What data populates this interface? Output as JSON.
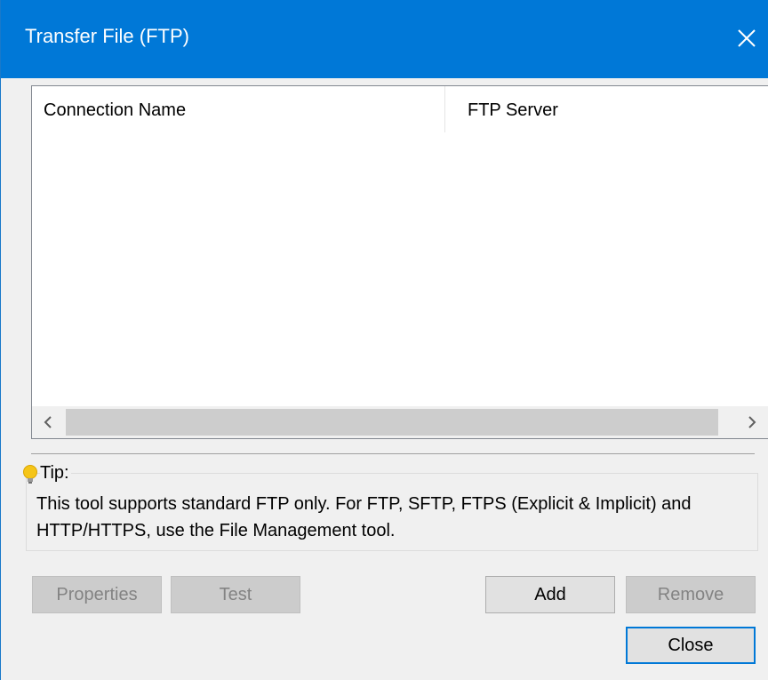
{
  "window": {
    "title": "Transfer File (FTP)"
  },
  "list": {
    "columns": [
      "Connection Name",
      "FTP Server"
    ],
    "rows": []
  },
  "tip": {
    "label": "Tip:",
    "text": "This tool supports standard FTP only. For FTP, SFTP, FTPS (Explicit & Implicit) and HTTP/HTTPS, use the File Management tool."
  },
  "buttons": {
    "properties": "Properties",
    "test": "Test",
    "add": "Add",
    "remove": "Remove",
    "close": "Close"
  },
  "icons": {
    "close": "close-icon",
    "scroll_left": "chevron-left-icon",
    "scroll_right": "chevron-right-icon",
    "tip": "lightbulb-icon"
  },
  "colors": {
    "titlebar": "#0078d7",
    "default_button_border": "#0078d7",
    "disabled_button": "#cccccc",
    "tip_bulb": "#f5c518"
  }
}
